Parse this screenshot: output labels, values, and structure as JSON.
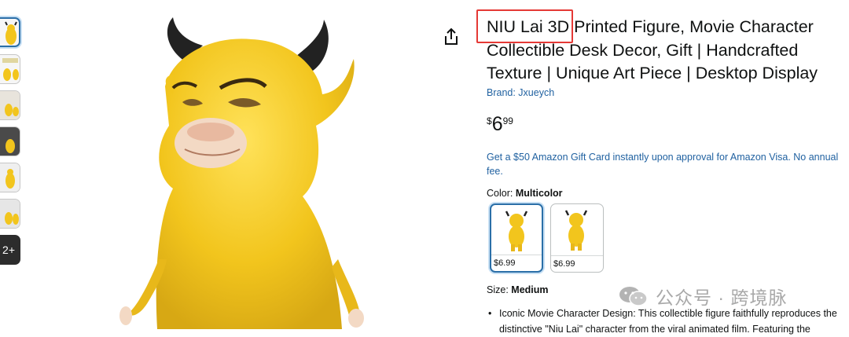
{
  "thumbnails": {
    "items": [
      {
        "name": "thumbnail-1"
      },
      {
        "name": "thumbnail-2"
      },
      {
        "name": "thumbnail-3"
      },
      {
        "name": "thumbnail-4"
      },
      {
        "name": "thumbnail-5"
      },
      {
        "name": "thumbnail-6"
      }
    ],
    "more_label": "2+"
  },
  "product": {
    "brand_word": "NIU Lai",
    "title_rest": " 3D Printed Figure, Movie Character Collectible Desk Decor, Gift | Handcrafted Texture | Unique Art Piece | Desktop Display",
    "brand_link": "Brand: Jxueych",
    "price": {
      "symbol": "$",
      "whole": "6",
      "fraction": "99"
    },
    "promo": "Get a $50 Amazon Gift Card instantly upon approval for Amazon Visa. No annual fee.",
    "color_label": "Color:",
    "color_value": "Multicolor",
    "swatches": [
      {
        "price": "$6.99"
      },
      {
        "price": "$6.99"
      }
    ],
    "size_label": "Size:",
    "size_value": "Medium",
    "bullets": [
      "Iconic Movie Character Design: This collectible figure faithfully reproduces the",
      "distinctive \"Niu Lai\" character from the viral animated film. Featuring the"
    ]
  },
  "watermark": {
    "text": "公众号 · 跨境脉"
  },
  "icons": {
    "share": "share-icon",
    "watermark": "wechat-icon"
  },
  "colors": {
    "link": "#2162a1",
    "highlight_box": "#e53935",
    "selected_border": "#2b6fa8",
    "figure_yellow": "#f2c51d"
  }
}
